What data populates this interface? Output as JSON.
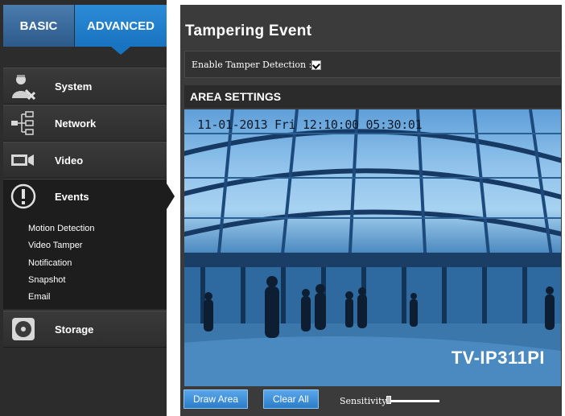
{
  "tabs": {
    "basic": "BASIC",
    "advanced": "ADVANCED"
  },
  "sidebar": {
    "items": [
      {
        "label": "System",
        "icon": "user-gear-icon"
      },
      {
        "label": "Network",
        "icon": "network-tree-icon"
      },
      {
        "label": "Video",
        "icon": "camera-icon"
      },
      {
        "label": "Events",
        "icon": "alert-icon",
        "active": true
      },
      {
        "label": "Storage",
        "icon": "storage-disc-icon"
      }
    ],
    "events_submenu": [
      "Motion Detection",
      "Video Tamper",
      "Notification",
      "Snapshot",
      "Email"
    ]
  },
  "main": {
    "title": "Tampering Event",
    "tamper": {
      "label": "Enable Tamper Detection :",
      "checked": true
    },
    "area": {
      "title": "AREA SETTINGS",
      "timestamp": "11-01-2013 Fri 12:10:00 05:30:01",
      "watermark": "TV-IP311PI"
    },
    "buttons": {
      "draw": "Draw Area",
      "clear": "Clear All"
    },
    "sensitivity": {
      "label": "Sensitivity",
      "level": 0
    }
  },
  "colors": {
    "sidebar_bg": "#2c2c2c",
    "main_bg": "#3b3b3b",
    "accent_blue": "#1873c0",
    "button_blue": "#2a7cc9"
  }
}
